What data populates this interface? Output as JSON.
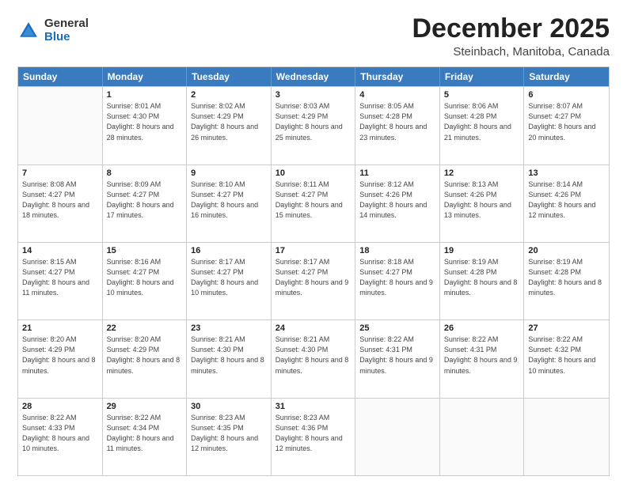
{
  "header": {
    "logo_general": "General",
    "logo_blue": "Blue",
    "month_title": "December 2025",
    "location": "Steinbach, Manitoba, Canada"
  },
  "weekdays": [
    "Sunday",
    "Monday",
    "Tuesday",
    "Wednesday",
    "Thursday",
    "Friday",
    "Saturday"
  ],
  "rows": [
    [
      {
        "day": "",
        "empty": true
      },
      {
        "day": "1",
        "sunrise": "Sunrise: 8:01 AM",
        "sunset": "Sunset: 4:30 PM",
        "daylight": "Daylight: 8 hours and 28 minutes."
      },
      {
        "day": "2",
        "sunrise": "Sunrise: 8:02 AM",
        "sunset": "Sunset: 4:29 PM",
        "daylight": "Daylight: 8 hours and 26 minutes."
      },
      {
        "day": "3",
        "sunrise": "Sunrise: 8:03 AM",
        "sunset": "Sunset: 4:29 PM",
        "daylight": "Daylight: 8 hours and 25 minutes."
      },
      {
        "day": "4",
        "sunrise": "Sunrise: 8:05 AM",
        "sunset": "Sunset: 4:28 PM",
        "daylight": "Daylight: 8 hours and 23 minutes."
      },
      {
        "day": "5",
        "sunrise": "Sunrise: 8:06 AM",
        "sunset": "Sunset: 4:28 PM",
        "daylight": "Daylight: 8 hours and 21 minutes."
      },
      {
        "day": "6",
        "sunrise": "Sunrise: 8:07 AM",
        "sunset": "Sunset: 4:27 PM",
        "daylight": "Daylight: 8 hours and 20 minutes."
      }
    ],
    [
      {
        "day": "7",
        "sunrise": "Sunrise: 8:08 AM",
        "sunset": "Sunset: 4:27 PM",
        "daylight": "Daylight: 8 hours and 18 minutes."
      },
      {
        "day": "8",
        "sunrise": "Sunrise: 8:09 AM",
        "sunset": "Sunset: 4:27 PM",
        "daylight": "Daylight: 8 hours and 17 minutes."
      },
      {
        "day": "9",
        "sunrise": "Sunrise: 8:10 AM",
        "sunset": "Sunset: 4:27 PM",
        "daylight": "Daylight: 8 hours and 16 minutes."
      },
      {
        "day": "10",
        "sunrise": "Sunrise: 8:11 AM",
        "sunset": "Sunset: 4:27 PM",
        "daylight": "Daylight: 8 hours and 15 minutes."
      },
      {
        "day": "11",
        "sunrise": "Sunrise: 8:12 AM",
        "sunset": "Sunset: 4:26 PM",
        "daylight": "Daylight: 8 hours and 14 minutes."
      },
      {
        "day": "12",
        "sunrise": "Sunrise: 8:13 AM",
        "sunset": "Sunset: 4:26 PM",
        "daylight": "Daylight: 8 hours and 13 minutes."
      },
      {
        "day": "13",
        "sunrise": "Sunrise: 8:14 AM",
        "sunset": "Sunset: 4:26 PM",
        "daylight": "Daylight: 8 hours and 12 minutes."
      }
    ],
    [
      {
        "day": "14",
        "sunrise": "Sunrise: 8:15 AM",
        "sunset": "Sunset: 4:27 PM",
        "daylight": "Daylight: 8 hours and 11 minutes."
      },
      {
        "day": "15",
        "sunrise": "Sunrise: 8:16 AM",
        "sunset": "Sunset: 4:27 PM",
        "daylight": "Daylight: 8 hours and 10 minutes."
      },
      {
        "day": "16",
        "sunrise": "Sunrise: 8:17 AM",
        "sunset": "Sunset: 4:27 PM",
        "daylight": "Daylight: 8 hours and 10 minutes."
      },
      {
        "day": "17",
        "sunrise": "Sunrise: 8:17 AM",
        "sunset": "Sunset: 4:27 PM",
        "daylight": "Daylight: 8 hours and 9 minutes."
      },
      {
        "day": "18",
        "sunrise": "Sunrise: 8:18 AM",
        "sunset": "Sunset: 4:27 PM",
        "daylight": "Daylight: 8 hours and 9 minutes."
      },
      {
        "day": "19",
        "sunrise": "Sunrise: 8:19 AM",
        "sunset": "Sunset: 4:28 PM",
        "daylight": "Daylight: 8 hours and 8 minutes."
      },
      {
        "day": "20",
        "sunrise": "Sunrise: 8:19 AM",
        "sunset": "Sunset: 4:28 PM",
        "daylight": "Daylight: 8 hours and 8 minutes."
      }
    ],
    [
      {
        "day": "21",
        "sunrise": "Sunrise: 8:20 AM",
        "sunset": "Sunset: 4:29 PM",
        "daylight": "Daylight: 8 hours and 8 minutes."
      },
      {
        "day": "22",
        "sunrise": "Sunrise: 8:20 AM",
        "sunset": "Sunset: 4:29 PM",
        "daylight": "Daylight: 8 hours and 8 minutes."
      },
      {
        "day": "23",
        "sunrise": "Sunrise: 8:21 AM",
        "sunset": "Sunset: 4:30 PM",
        "daylight": "Daylight: 8 hours and 8 minutes."
      },
      {
        "day": "24",
        "sunrise": "Sunrise: 8:21 AM",
        "sunset": "Sunset: 4:30 PM",
        "daylight": "Daylight: 8 hours and 8 minutes."
      },
      {
        "day": "25",
        "sunrise": "Sunrise: 8:22 AM",
        "sunset": "Sunset: 4:31 PM",
        "daylight": "Daylight: 8 hours and 9 minutes."
      },
      {
        "day": "26",
        "sunrise": "Sunrise: 8:22 AM",
        "sunset": "Sunset: 4:31 PM",
        "daylight": "Daylight: 8 hours and 9 minutes."
      },
      {
        "day": "27",
        "sunrise": "Sunrise: 8:22 AM",
        "sunset": "Sunset: 4:32 PM",
        "daylight": "Daylight: 8 hours and 10 minutes."
      }
    ],
    [
      {
        "day": "28",
        "sunrise": "Sunrise: 8:22 AM",
        "sunset": "Sunset: 4:33 PM",
        "daylight": "Daylight: 8 hours and 10 minutes."
      },
      {
        "day": "29",
        "sunrise": "Sunrise: 8:22 AM",
        "sunset": "Sunset: 4:34 PM",
        "daylight": "Daylight: 8 hours and 11 minutes."
      },
      {
        "day": "30",
        "sunrise": "Sunrise: 8:23 AM",
        "sunset": "Sunset: 4:35 PM",
        "daylight": "Daylight: 8 hours and 12 minutes."
      },
      {
        "day": "31",
        "sunrise": "Sunrise: 8:23 AM",
        "sunset": "Sunset: 4:36 PM",
        "daylight": "Daylight: 8 hours and 12 minutes."
      },
      {
        "day": "",
        "empty": true
      },
      {
        "day": "",
        "empty": true
      },
      {
        "day": "",
        "empty": true
      }
    ]
  ]
}
